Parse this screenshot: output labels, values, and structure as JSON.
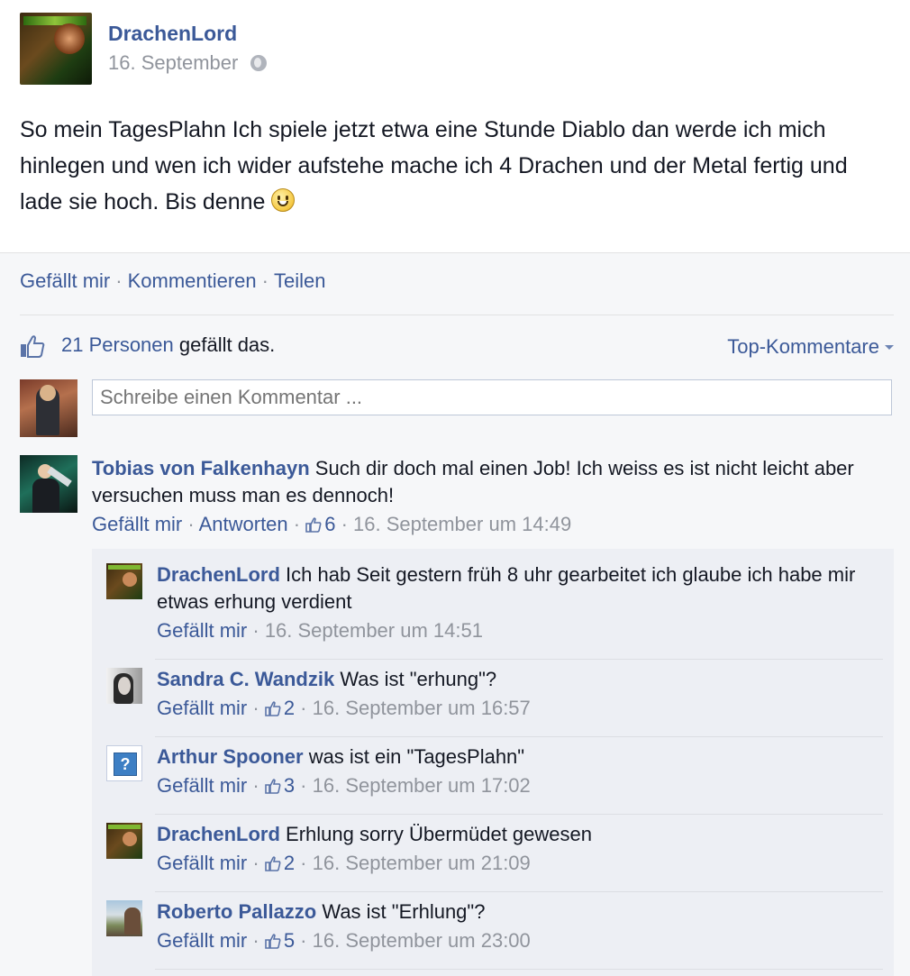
{
  "post": {
    "author": "DrachenLord",
    "date": "16. September",
    "text": "So mein TagesPlahn Ich spiele jetzt etwa eine Stunde Diablo dan werde ich mich hinlegen und wen ich wider aufstehe mache ich 4 Drachen und der Metal fertig und lade sie hoch. Bis denne"
  },
  "actions": {
    "like": "Gefällt mir",
    "comment": "Kommentieren",
    "share": "Teilen",
    "sep": "·"
  },
  "likes": {
    "count_link": "21 Personen",
    "suffix": " gefällt das.",
    "top_comments": "Top-Kommentare"
  },
  "composer": {
    "placeholder": "Schreibe einen Kommentar ..."
  },
  "comments": [
    {
      "author": "Tobias von Falkenhayn",
      "text": "Such dir doch mal einen Job! Ich weiss es ist nicht leicht aber versuchen muss man es dennoch!",
      "like": "Gefällt mir",
      "reply": "Antworten",
      "likes": "6",
      "time": "16. September um 14:49"
    }
  ],
  "replies": [
    {
      "author": "DrachenLord",
      "text": "Ich hab Seit gestern früh 8 uhr gearbeitet ich glaube ich habe mir etwas erhung verdient",
      "like": "Gefällt mir",
      "likes": "",
      "time": "16. September um 14:51"
    },
    {
      "author": "Sandra C. Wandzik",
      "text": "Was ist \"erhung\"?",
      "like": "Gefällt mir",
      "likes": "2",
      "time": "16. September um 16:57"
    },
    {
      "author": "Arthur Spooner",
      "text": "was ist ein \"TagesPlahn\"",
      "like": "Gefällt mir",
      "likes": "3",
      "time": "16. September um 17:02"
    },
    {
      "author": "DrachenLord",
      "text": "Erhlung sorry Übermüdet gewesen",
      "like": "Gefällt mir",
      "likes": "2",
      "time": "16. September um 21:09"
    },
    {
      "author": "Roberto Pallazzo",
      "text": "Was ist \"Erhlung\"?",
      "like": "Gefällt mir",
      "likes": "5",
      "time": "16. September um 23:00"
    }
  ],
  "colors": {
    "link": "#3b5998",
    "meta": "#90949c",
    "feedback_bg": "#f6f7f9",
    "replies_bg": "#edeff4"
  }
}
